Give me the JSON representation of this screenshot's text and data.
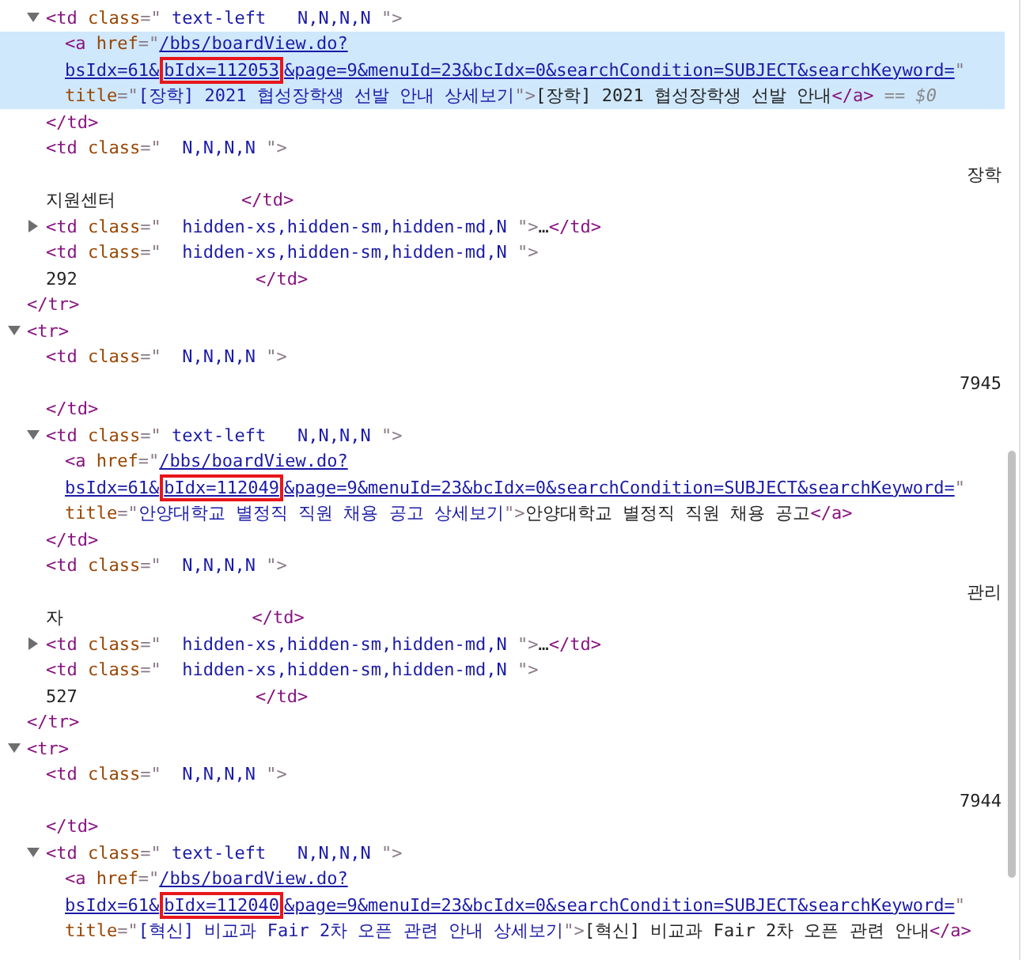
{
  "tree": [
    {
      "kind": "element",
      "children": [
        {
          "kind": "element",
          "expanded": true,
          "lines": [
            {
              "parts": [
                {
                  "kind": "tag",
                  "text": "<td"
                },
                {
                  "kind": "attr",
                  "text": " class"
                },
                {
                  "kind": "punct",
                  "text": "=\""
                },
                {
                  "kind": "value",
                  "text": " text-left   N,N,N,N "
                },
                {
                  "kind": "punct",
                  "text": "\">"
                }
              ]
            }
          ],
          "children": [
            {
              "kind": "element",
              "selected": true,
              "lines": [
                {
                  "parts": [
                    {
                      "kind": "tag",
                      "text": "<a"
                    },
                    {
                      "kind": "attr",
                      "text": " href"
                    },
                    {
                      "kind": "punct",
                      "text": "=\""
                    },
                    {
                      "kind": "link",
                      "text": "/bbs/boardView.do?"
                    }
                  ]
                },
                {
                  "parts": [
                    {
                      "kind": "link",
                      "text": "bsIdx=61&"
                    },
                    {
                      "kind": "link",
                      "text": "bIdx=112053",
                      "boxed": true
                    },
                    {
                      "kind": "link",
                      "text": "&page=9&menuId=23&bcIdx=0&searchCondition=SUBJECT&searchKeyword="
                    },
                    {
                      "kind": "punct",
                      "text": "\""
                    }
                  ]
                },
                {
                  "parts": [
                    {
                      "kind": "attr",
                      "text": "title"
                    },
                    {
                      "kind": "punct",
                      "text": "=\""
                    },
                    {
                      "kind": "value",
                      "text": "[장학] 2021 협성장학생 선발 안내 상세보기"
                    },
                    {
                      "kind": "punct",
                      "text": "\">"
                    },
                    {
                      "kind": "text",
                      "text": "[장학] 2021 협성장학생 선발 안내"
                    },
                    {
                      "kind": "tag",
                      "text": "</a>"
                    },
                    {
                      "kind": "hint",
                      "text": " == $0"
                    }
                  ]
                }
              ]
            }
          ],
          "close": {
            "parts": [
              {
                "kind": "tag",
                "text": "</td>"
              }
            ]
          }
        },
        {
          "kind": "element",
          "lines": [
            {
              "parts": [
                {
                  "kind": "tag",
                  "text": "<td"
                },
                {
                  "kind": "attr",
                  "text": " class"
                },
                {
                  "kind": "punct",
                  "text": "=\""
                },
                {
                  "kind": "value",
                  "text": "  N,N,N,N "
                },
                {
                  "kind": "punct",
                  "text": "\">"
                }
              ]
            },
            {
              "kind": "end",
              "parts": [
                {
                  "kind": "text",
                  "text": "장학"
                }
              ]
            },
            {
              "parts": [
                {
                  "kind": "text",
                  "text": "지원센터            "
                },
                {
                  "kind": "tag",
                  "text": "</td>"
                }
              ]
            }
          ]
        },
        {
          "kind": "element",
          "expanded": false,
          "lines": [
            {
              "parts": [
                {
                  "kind": "tag",
                  "text": "<td"
                },
                {
                  "kind": "attr",
                  "text": " class"
                },
                {
                  "kind": "punct",
                  "text": "=\""
                },
                {
                  "kind": "value",
                  "text": "  hidden-xs,hidden-sm,hidden-md,N "
                },
                {
                  "kind": "punct",
                  "text": "\">"
                },
                {
                  "kind": "text",
                  "text": "…"
                },
                {
                  "kind": "tag",
                  "text": "</td>"
                }
              ]
            }
          ]
        },
        {
          "kind": "element",
          "lines": [
            {
              "parts": [
                {
                  "kind": "tag",
                  "text": "<td"
                },
                {
                  "kind": "attr",
                  "text": " class"
                },
                {
                  "kind": "punct",
                  "text": "=\""
                },
                {
                  "kind": "value",
                  "text": "  hidden-xs,hidden-sm,hidden-md,N "
                },
                {
                  "kind": "punct",
                  "text": "\">"
                }
              ]
            },
            {
              "parts": [
                {
                  "kind": "text",
                  "text": "292                 "
                },
                {
                  "kind": "tag",
                  "text": "</td>"
                }
              ]
            }
          ]
        }
      ],
      "close": {
        "parts": [
          {
            "kind": "tag",
            "text": "</tr>"
          }
        ]
      }
    },
    {
      "kind": "element",
      "expanded": true,
      "lines": [
        {
          "parts": [
            {
              "kind": "tag",
              "text": "<tr>"
            }
          ]
        }
      ],
      "children": [
        {
          "kind": "element",
          "lines": [
            {
              "parts": [
                {
                  "kind": "tag",
                  "text": "<td"
                },
                {
                  "kind": "attr",
                  "text": " class"
                },
                {
                  "kind": "punct",
                  "text": "=\""
                },
                {
                  "kind": "value",
                  "text": "  N,N,N,N "
                },
                {
                  "kind": "punct",
                  "text": "\">"
                }
              ]
            },
            {
              "kind": "end",
              "parts": [
                {
                  "kind": "text",
                  "text": "7945"
                }
              ]
            },
            {
              "parts": [
                {
                  "kind": "tag",
                  "text": "</td>"
                }
              ]
            }
          ]
        },
        {
          "kind": "element",
          "expanded": true,
          "lines": [
            {
              "parts": [
                {
                  "kind": "tag",
                  "text": "<td"
                },
                {
                  "kind": "attr",
                  "text": " class"
                },
                {
                  "kind": "punct",
                  "text": "=\""
                },
                {
                  "kind": "value",
                  "text": " text-left   N,N,N,N "
                },
                {
                  "kind": "punct",
                  "text": "\">"
                }
              ]
            }
          ],
          "children": [
            {
              "kind": "element",
              "selected": false,
              "lines": [
                {
                  "parts": [
                    {
                      "kind": "tag",
                      "text": "<a"
                    },
                    {
                      "kind": "attr",
                      "text": " href"
                    },
                    {
                      "kind": "punct",
                      "text": "=\""
                    },
                    {
                      "kind": "link",
                      "text": "/bbs/boardView.do?"
                    }
                  ]
                },
                {
                  "parts": [
                    {
                      "kind": "link",
                      "text": "bsIdx=61&"
                    },
                    {
                      "kind": "link",
                      "text": "bIdx=112049",
                      "boxed": true
                    },
                    {
                      "kind": "link",
                      "text": "&page=9&menuId=23&bcIdx=0&searchCondition=SUBJECT&searchKeyword="
                    },
                    {
                      "kind": "punct",
                      "text": "\""
                    }
                  ]
                },
                {
                  "parts": [
                    {
                      "kind": "attr",
                      "text": "title"
                    },
                    {
                      "kind": "punct",
                      "text": "=\""
                    },
                    {
                      "kind": "value",
                      "text": "안양대학교 별정직 직원 채용 공고 상세보기"
                    },
                    {
                      "kind": "punct",
                      "text": "\">"
                    },
                    {
                      "kind": "text",
                      "text": "안양대학교 별정직 직원 채용 공고"
                    },
                    {
                      "kind": "tag",
                      "text": "</a>"
                    }
                  ]
                }
              ]
            }
          ],
          "close": {
            "parts": [
              {
                "kind": "tag",
                "text": "</td>"
              }
            ]
          }
        },
        {
          "kind": "element",
          "lines": [
            {
              "parts": [
                {
                  "kind": "tag",
                  "text": "<td"
                },
                {
                  "kind": "attr",
                  "text": " class"
                },
                {
                  "kind": "punct",
                  "text": "=\""
                },
                {
                  "kind": "value",
                  "text": "  N,N,N,N "
                },
                {
                  "kind": "punct",
                  "text": "\">"
                }
              ]
            },
            {
              "kind": "end",
              "parts": [
                {
                  "kind": "text",
                  "text": "관리"
                }
              ]
            },
            {
              "parts": [
                {
                  "kind": "text",
                  "text": "자                  "
                },
                {
                  "kind": "tag",
                  "text": "</td>"
                }
              ]
            }
          ]
        },
        {
          "kind": "element",
          "expanded": false,
          "lines": [
            {
              "parts": [
                {
                  "kind": "tag",
                  "text": "<td"
                },
                {
                  "kind": "attr",
                  "text": " class"
                },
                {
                  "kind": "punct",
                  "text": "=\""
                },
                {
                  "kind": "value",
                  "text": "  hidden-xs,hidden-sm,hidden-md,N "
                },
                {
                  "kind": "punct",
                  "text": "\">"
                },
                {
                  "kind": "text",
                  "text": "…"
                },
                {
                  "kind": "tag",
                  "text": "</td>"
                }
              ]
            }
          ]
        },
        {
          "kind": "element",
          "lines": [
            {
              "parts": [
                {
                  "kind": "tag",
                  "text": "<td"
                },
                {
                  "kind": "attr",
                  "text": " class"
                },
                {
                  "kind": "punct",
                  "text": "=\""
                },
                {
                  "kind": "value",
                  "text": "  hidden-xs,hidden-sm,hidden-md,N "
                },
                {
                  "kind": "punct",
                  "text": "\">"
                }
              ]
            },
            {
              "parts": [
                {
                  "kind": "text",
                  "text": "527                 "
                },
                {
                  "kind": "tag",
                  "text": "</td>"
                }
              ]
            }
          ]
        }
      ],
      "close": {
        "parts": [
          {
            "kind": "tag",
            "text": "</tr>"
          }
        ]
      }
    },
    {
      "kind": "element",
      "expanded": true,
      "lines": [
        {
          "parts": [
            {
              "kind": "tag",
              "text": "<tr>"
            }
          ]
        }
      ],
      "children": [
        {
          "kind": "element",
          "lines": [
            {
              "parts": [
                {
                  "kind": "tag",
                  "text": "<td"
                },
                {
                  "kind": "attr",
                  "text": " class"
                },
                {
                  "kind": "punct",
                  "text": "=\""
                },
                {
                  "kind": "value",
                  "text": "  N,N,N,N "
                },
                {
                  "kind": "punct",
                  "text": "\">"
                }
              ]
            },
            {
              "kind": "end",
              "parts": [
                {
                  "kind": "text",
                  "text": "7944"
                }
              ]
            },
            {
              "parts": [
                {
                  "kind": "tag",
                  "text": "</td>"
                }
              ]
            }
          ]
        },
        {
          "kind": "element",
          "expanded": true,
          "lines": [
            {
              "parts": [
                {
                  "kind": "tag",
                  "text": "<td"
                },
                {
                  "kind": "attr",
                  "text": " class"
                },
                {
                  "kind": "punct",
                  "text": "=\""
                },
                {
                  "kind": "value",
                  "text": " text-left   N,N,N,N "
                },
                {
                  "kind": "punct",
                  "text": "\">"
                }
              ]
            }
          ],
          "children": [
            {
              "kind": "element",
              "selected": false,
              "lines": [
                {
                  "parts": [
                    {
                      "kind": "tag",
                      "text": "<a"
                    },
                    {
                      "kind": "attr",
                      "text": " href"
                    },
                    {
                      "kind": "punct",
                      "text": "=\""
                    },
                    {
                      "kind": "link",
                      "text": "/bbs/boardView.do?"
                    }
                  ]
                },
                {
                  "parts": [
                    {
                      "kind": "link",
                      "text": "bsIdx=61&"
                    },
                    {
                      "kind": "link",
                      "text": "bIdx=112040",
                      "boxed": true
                    },
                    {
                      "kind": "link",
                      "text": "&page=9&menuId=23&bcIdx=0&searchCondition=SUBJECT&searchKeyword="
                    },
                    {
                      "kind": "punct",
                      "text": "\""
                    }
                  ]
                },
                {
                  "parts": [
                    {
                      "kind": "attr",
                      "text": "title"
                    },
                    {
                      "kind": "punct",
                      "text": "=\""
                    },
                    {
                      "kind": "value",
                      "text": "[혁신] 비교과 Fair 2차 오픈 관련 안내 상세보기"
                    },
                    {
                      "kind": "punct",
                      "text": "\">"
                    },
                    {
                      "kind": "text",
                      "text": "[혁신] 비교과 Fair 2차 오픈 관련 안내"
                    },
                    {
                      "kind": "tag",
                      "text": "</a>"
                    }
                  ]
                }
              ]
            }
          ]
        }
      ]
    }
  ]
}
